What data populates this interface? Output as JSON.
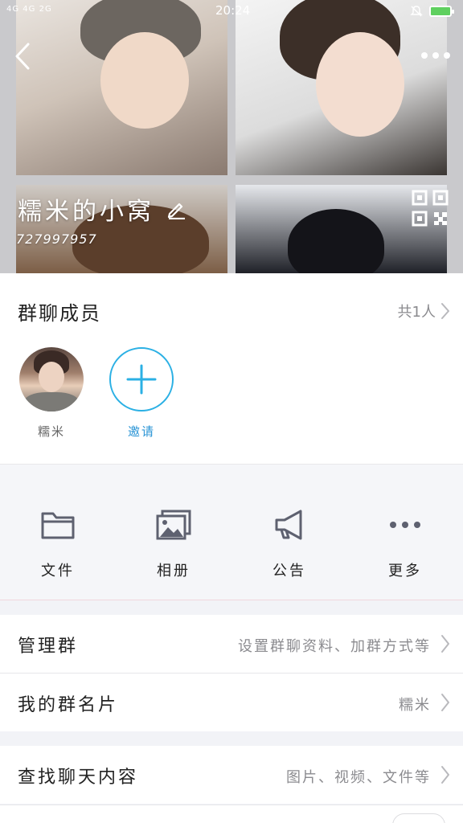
{
  "status_bar": {
    "network": "4G 4G 2G",
    "time": "20:24"
  },
  "group": {
    "name": "糯米的小窝",
    "id": "727997957"
  },
  "members": {
    "title": "群聊成员",
    "count_label": "共1人",
    "list": [
      {
        "name": "糯米"
      }
    ],
    "invite_label": "邀请"
  },
  "actions": [
    {
      "label": "文件",
      "icon": "folder-icon"
    },
    {
      "label": "相册",
      "icon": "album-icon"
    },
    {
      "label": "公告",
      "icon": "megaphone-icon"
    },
    {
      "label": "更多",
      "icon": "more-dots-icon"
    }
  ],
  "rows": {
    "manage": {
      "title": "管理群",
      "value": "设置群聊资料、加群方式等"
    },
    "card": {
      "title": "我的群名片",
      "value": "糯米"
    },
    "search": {
      "title": "查找聊天内容",
      "value": "图片、视频、文件等"
    }
  },
  "colors": {
    "accent": "#2bb0e4",
    "icon_gray": "#5e6170",
    "text_secondary": "#8b8b8f"
  }
}
